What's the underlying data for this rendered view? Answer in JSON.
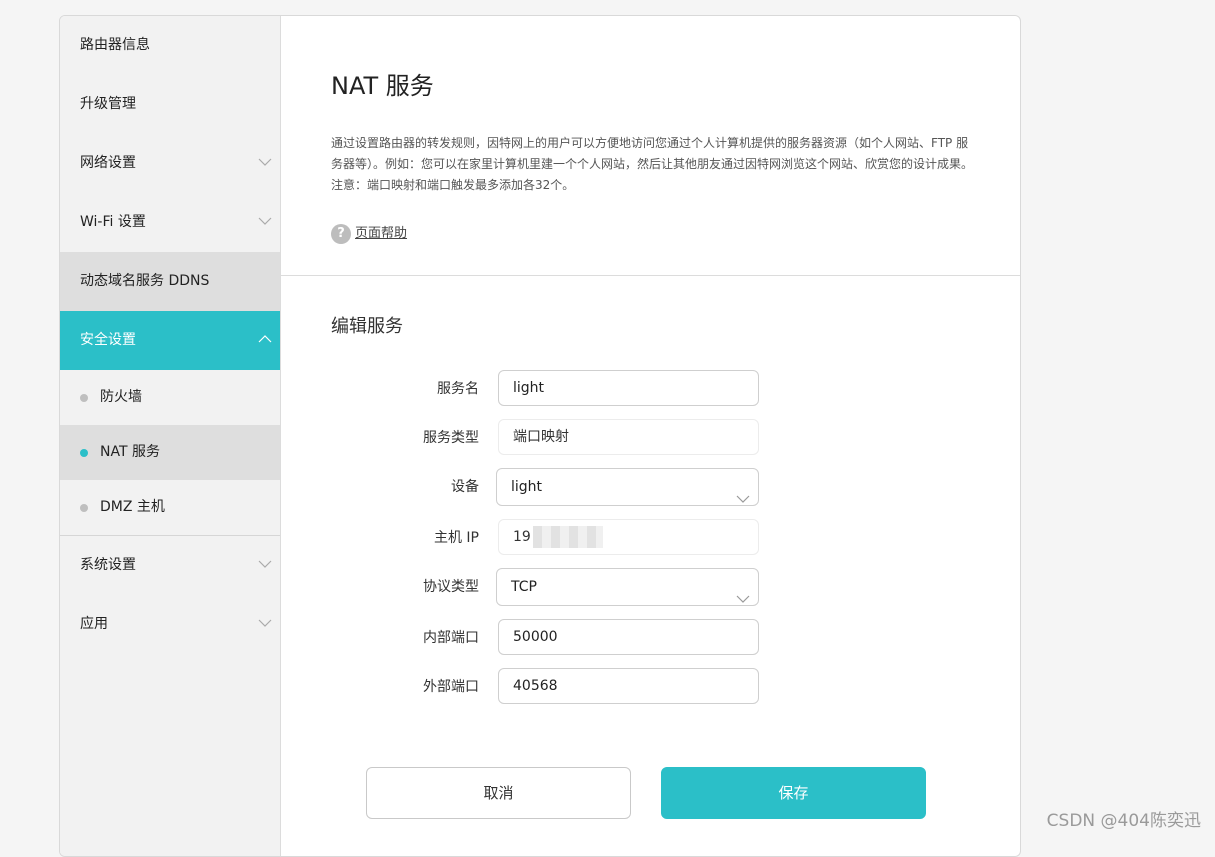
{
  "sidebar": {
    "items": [
      {
        "label": "路由器信息"
      },
      {
        "label": "升级管理"
      },
      {
        "label": "网络设置"
      },
      {
        "label": "Wi-Fi 设置"
      },
      {
        "label": "动态域名服务 DDNS"
      },
      {
        "label": "安全设置"
      }
    ],
    "sub_items": [
      {
        "label": "防火墙"
      },
      {
        "label": "NAT 服务"
      },
      {
        "label": "DMZ 主机"
      }
    ],
    "bottom_items": [
      {
        "label": "系统设置"
      },
      {
        "label": "应用"
      }
    ],
    "active_color": "#2bbfc8"
  },
  "main": {
    "title": "NAT 服务",
    "description": "通过设置路由器的转发规则，因特网上的用户可以方便地访问您通过个人计算机提供的服务器资源（如个人网站、FTP 服务器等）。例如：您可以在家里计算机里建一个个人网站，然后让其他朋友通过因特网浏览这个网站、欣赏您的设计成果。注意：端口映射和端口触发最多添加各32个。",
    "help_label": "页面帮助",
    "help_icon": "?",
    "section_title": "编辑服务"
  },
  "form": {
    "service_name": {
      "label": "服务名",
      "value": "light"
    },
    "service_type": {
      "label": "服务类型",
      "value": "端口映射"
    },
    "device": {
      "label": "设备",
      "value": "light"
    },
    "host_ip": {
      "label": "主机 IP",
      "value": "19"
    },
    "protocol": {
      "label": "协议类型",
      "value": "TCP"
    },
    "internal_port": {
      "label": "内部端口",
      "value": "50000"
    },
    "external_port": {
      "label": "外部端口",
      "value": "40568"
    }
  },
  "buttons": {
    "cancel": "取消",
    "save": "保存"
  },
  "watermark": "CSDN @404陈奕迅"
}
